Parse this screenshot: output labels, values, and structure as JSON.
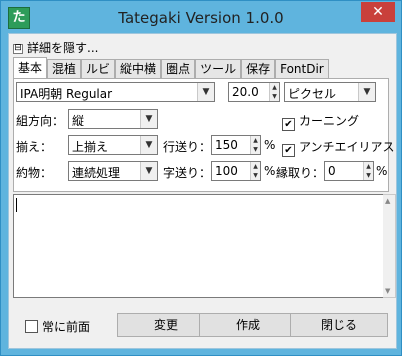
{
  "window": {
    "title": "Tategaki Version 1.0.0",
    "app_icon_glyph": "た",
    "close_glyph": "✕"
  },
  "details_toggle": {
    "box": "⊟",
    "label": "詳細を隠す..."
  },
  "tabs": [
    "基本",
    "混植",
    "ルビ",
    "縦中横",
    "圏点",
    "ツール",
    "保存",
    "FontDir"
  ],
  "font": {
    "family": "IPA明朝 Regular",
    "size": "20.0",
    "unit": "ピクセル"
  },
  "direction": {
    "label": "組方向：",
    "value": "縦"
  },
  "kerning": {
    "label": "カーニング",
    "checked": "✔"
  },
  "align": {
    "label": "揃え：",
    "value": "上揃え"
  },
  "line_spacing": {
    "label": "行送り：",
    "value": "150",
    "unit": "%"
  },
  "antialias": {
    "label": "アンチエイリアス",
    "checked": "✔"
  },
  "kinsoku": {
    "label": "約物：",
    "value": "連続処理"
  },
  "char_spacing": {
    "label": "字送り：",
    "value": "100",
    "unit": "%"
  },
  "margin": {
    "label": "縁取り：",
    "value": "0",
    "unit": "%"
  },
  "text": {
    "value": ""
  },
  "always_on_top": {
    "label": "常に前面",
    "checked": ""
  },
  "buttons": {
    "convert": "変更",
    "create": "作成",
    "close": "閉じる"
  }
}
